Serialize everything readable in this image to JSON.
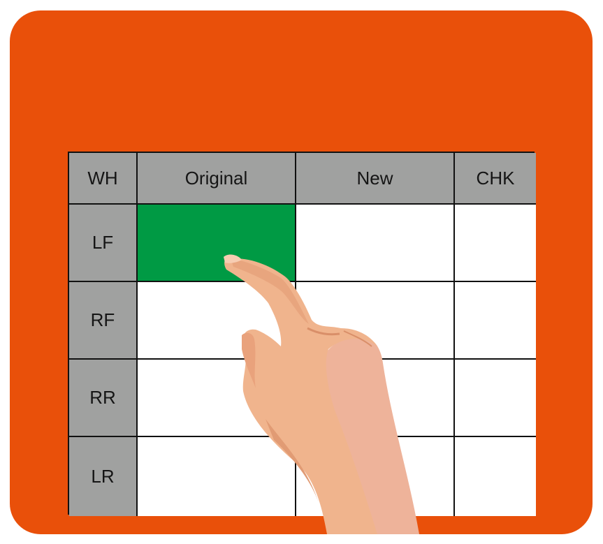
{
  "colors": {
    "panel": "#e9500a",
    "header_fill": "#a0a1a0",
    "active_cell": "#009a44",
    "grid_line": "#111111",
    "skin": "#f0b48d",
    "skin_shadow": "#e09a72"
  },
  "table": {
    "headers": [
      "WH",
      "Original",
      "New",
      "CHK"
    ],
    "rows": [
      {
        "label": "LF"
      },
      {
        "label": "RF"
      },
      {
        "label": "RR"
      },
      {
        "label": "LR"
      }
    ],
    "active_cell": {
      "row": "LF",
      "column": "Original"
    }
  },
  "illustration": {
    "icon": "pointing-hand-icon"
  }
}
